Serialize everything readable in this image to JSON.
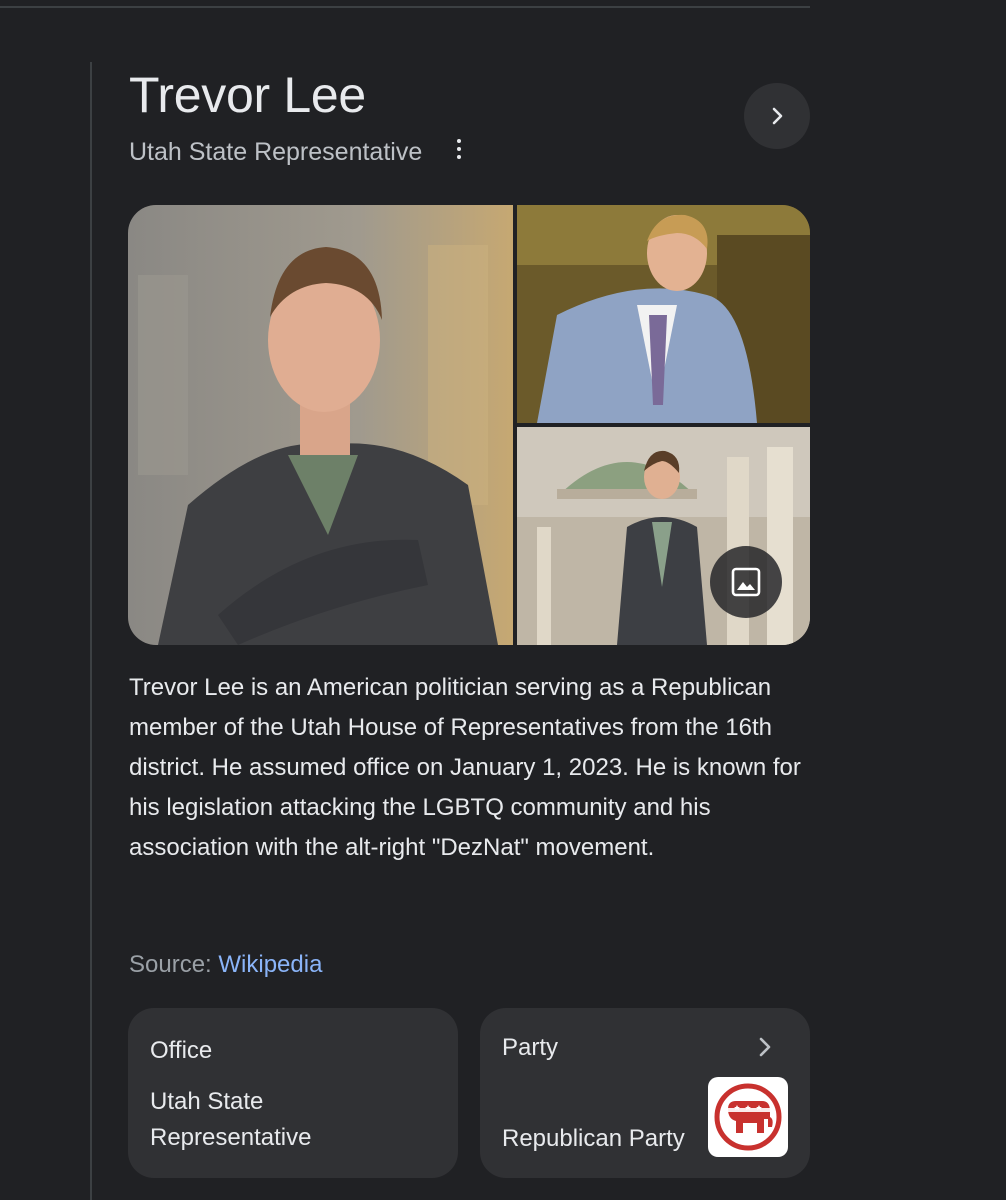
{
  "header": {
    "title": "Trevor Lee",
    "subtitle": "Utah State Representative"
  },
  "icons": {
    "more": "more-vert-icon",
    "next": "chevron-right-icon",
    "images": "image-icon",
    "party_chevron": "chevron-right-icon"
  },
  "description": "Trevor Lee is an American politician serving as a Republican member of the Utah House of Representatives from the 16th district. He assumed office on January 1, 2023. He is known for his legislation attacking the LGBTQ community and his association with the alt-right \"DezNat\" movement.",
  "source": {
    "label": "Source: ",
    "link_text": "Wikipedia"
  },
  "cards": {
    "office": {
      "label": "Office",
      "value_line1": "Utah State",
      "value_line2": "Representative"
    },
    "party": {
      "label": "Party",
      "value": "Republican Party"
    }
  },
  "colors": {
    "background": "#202124",
    "card": "#303134",
    "link": "#8ab4f8",
    "gop_red": "#c8312e"
  }
}
